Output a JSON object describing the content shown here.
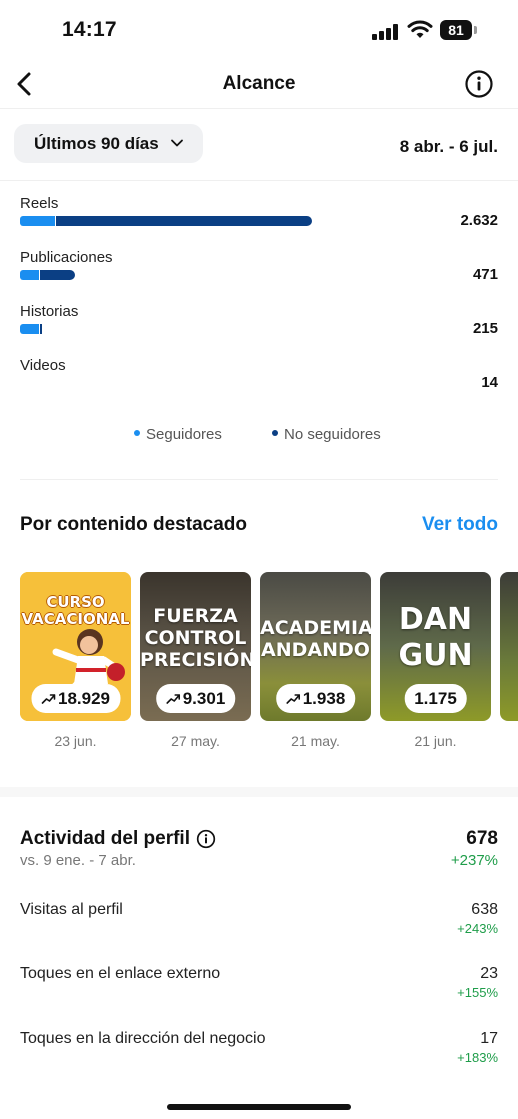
{
  "status_bar": {
    "time": "14:17",
    "battery": "81"
  },
  "header": {
    "title": "Alcance"
  },
  "filter": {
    "range_label": "Últimos 90 días",
    "dates": "8 abr. - 6 jul."
  },
  "reach_rows": [
    {
      "label": "Reels",
      "value": "2.632",
      "followers_frac": 0.015,
      "non_followers_frac": 0.11
    },
    {
      "label": "Publicaciones",
      "value": "471",
      "followers_frac": 0.008,
      "non_followers_frac": 0.015
    },
    {
      "label": "Historias",
      "value": "215",
      "followers_frac": 0.008,
      "non_followers_frac": 0.001
    },
    {
      "label": "Videos",
      "value": "14",
      "followers_frac": 0,
      "non_followers_frac": 0
    }
  ],
  "legend": {
    "followers": {
      "label": "Seguidores",
      "color": "#1a8ef0"
    },
    "non_followers": {
      "label": "No seguidores",
      "color": "#0b3f84"
    }
  },
  "featured": {
    "title": "Por contenido destacado",
    "see_all": "Ver todo",
    "items": [
      {
        "overlay": "CURSO VACACIONAL",
        "count": "18.929",
        "date": "23 jun.",
        "trend_icon": "trend-up-icon"
      },
      {
        "overlay": "FUERZA CONTROL PRECISIÓN",
        "count": "9.301",
        "date": "27 may.",
        "trend_icon": "trend-up-icon"
      },
      {
        "overlay": "ACADEMIA ANDANDO",
        "count": "1.938",
        "date": "21 may.",
        "trend_icon": "trend-up-icon"
      },
      {
        "overlay": "DAN GUN",
        "count": "1.175",
        "date": "21 jun.",
        "trend_icon": ""
      }
    ]
  },
  "activity": {
    "title": "Actividad del perfil",
    "compare": "vs. 9 ene. - 7 abr.",
    "total": "678",
    "total_change": "+237%",
    "metrics": [
      {
        "label": "Visitas al perfil",
        "value": "638",
        "change": "+243%"
      },
      {
        "label": "Toques en el enlace externo",
        "value": "23",
        "change": "+155%"
      },
      {
        "label": "Toques en la dirección del negocio",
        "value": "17",
        "change": "+183%"
      }
    ]
  }
}
